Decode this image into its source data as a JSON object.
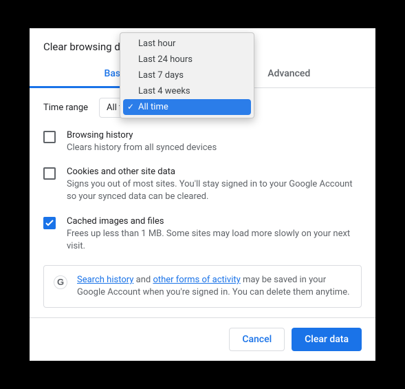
{
  "dialog": {
    "title": "Clear browsing data"
  },
  "tabs": {
    "basic": "Basic",
    "advanced": "Advanced"
  },
  "timeRange": {
    "label": "Time range",
    "selected": "All time",
    "options": [
      "Last hour",
      "Last 24 hours",
      "Last 7 days",
      "Last 4 weeks",
      "All time"
    ]
  },
  "items": [
    {
      "checked": false,
      "title": "Browsing history",
      "desc": "Clears history from all synced devices"
    },
    {
      "checked": false,
      "title": "Cookies and other site data",
      "desc": "Signs you out of most sites. You'll stay signed in to your Google Account so your synced data can be cleared."
    },
    {
      "checked": true,
      "title": "Cached images and files",
      "desc": "Frees up less than 1 MB. Some sites may load more slowly on your next visit."
    }
  ],
  "info": {
    "link1": "Search history",
    "mid1": " and ",
    "link2": "other forms of activity",
    "tail": " may be saved in your Google Account when you're signed in. You can delete them anytime."
  },
  "buttons": {
    "cancel": "Cancel",
    "clear": "Clear data"
  }
}
